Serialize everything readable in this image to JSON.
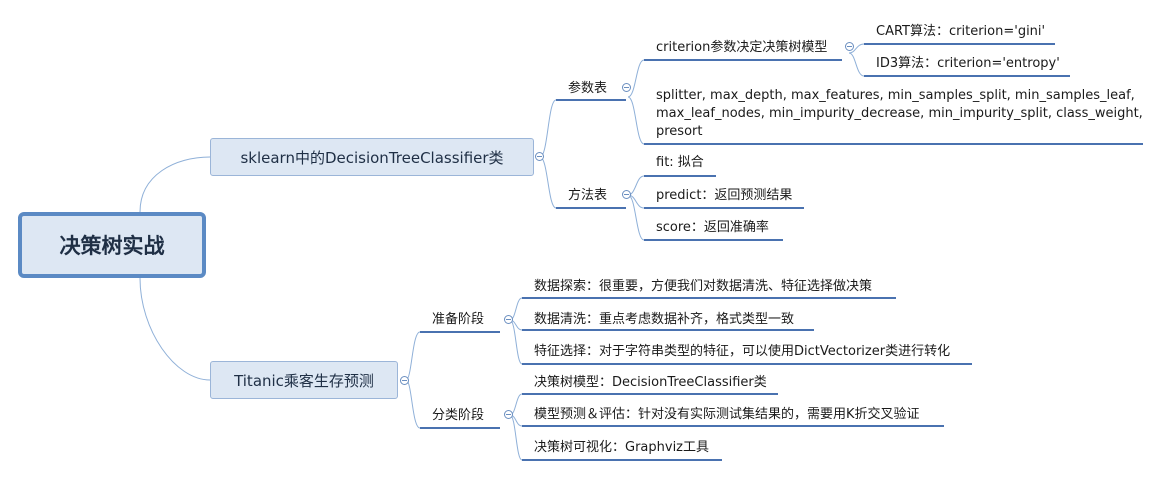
{
  "root": {
    "label": "决策树实战"
  },
  "branch1": {
    "label": "sklearn中的DecisionTreeClassifier类",
    "params": {
      "label": "参数表",
      "criterion": {
        "label": "criterion参数决定决策树模型",
        "cart": "CART算法：criterion='gini'",
        "id3": "ID3算法：criterion='entropy'"
      },
      "others": {
        "line1": "splitter, max_depth, max_features, min_samples_split, min_samples_leaf,",
        "line2": "max_leaf_nodes, min_impurity_decrease, min_impurity_split, class_weight,",
        "line3": "presort"
      }
    },
    "methods": {
      "label": "方法表",
      "fit": "fit: 拟合",
      "predict": "predict：返回预测结果",
      "score": "score：返回准确率"
    }
  },
  "branch2": {
    "label": "Titanic乘客生存预测",
    "prep": {
      "label": "准备阶段",
      "explore": "数据探索：很重要，方便我们对数据清洗、特征选择做决策",
      "clean": "数据清洗：重点考虑数据补齐，格式类型一致",
      "feature": "特征选择：对于字符串类型的特征，可以使用DictVectorizer类进行转化"
    },
    "classify": {
      "label": "分类阶段",
      "model": "决策树模型：DecisionTreeClassifier类",
      "eval": "模型预测＆评估：针对没有实际测试集结果的，需要用K折交叉验证",
      "viz": "决策树可视化：Graphviz工具"
    }
  },
  "colors": {
    "accent": "#5b8ac4",
    "underline": "#4a72b0",
    "connector": "#8fb0d8",
    "node_fill": "#dde7f3"
  }
}
